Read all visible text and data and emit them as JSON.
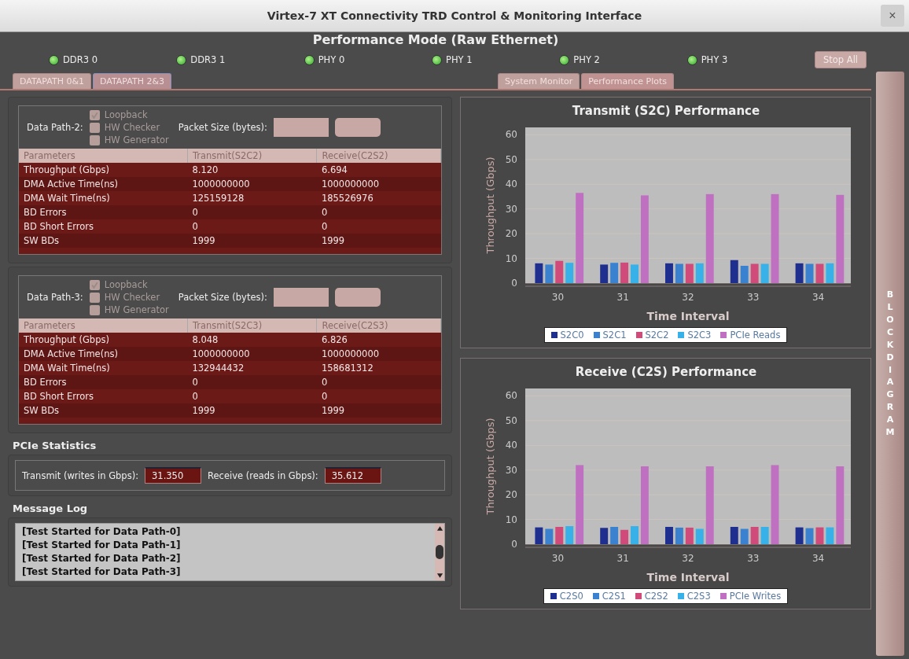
{
  "window": {
    "title": "Virtex-7 XT Connectivity TRD Control & Monitoring Interface",
    "close": "×"
  },
  "mode_title": "Performance Mode (Raw Ethernet)",
  "status_leds": [
    {
      "label": "DDR3 0",
      "on": true
    },
    {
      "label": "DDR3 1",
      "on": true
    },
    {
      "label": "PHY 0",
      "on": true
    },
    {
      "label": "PHY 1",
      "on": true
    },
    {
      "label": "PHY 2",
      "on": true
    },
    {
      "label": "PHY 3",
      "on": true
    }
  ],
  "stop_button": "Stop All",
  "left_tabs": [
    {
      "label": "DATAPATH 0&1",
      "selected": false
    },
    {
      "label": "DATAPATH 2&3",
      "selected": true
    }
  ],
  "right_tabs": [
    {
      "label": "System Monitor",
      "selected": false
    },
    {
      "label": "Performance Plots",
      "selected": true
    }
  ],
  "data_paths": [
    {
      "label": "Data Path-2:",
      "options": [
        {
          "label": "Loopback",
          "checked": true,
          "disabled": true
        },
        {
          "label": "HW Checker",
          "checked": false,
          "disabled": true
        },
        {
          "label": "HW Generator",
          "checked": false,
          "disabled": true
        }
      ],
      "packet_size_label": "Packet Size (bytes):",
      "columns": [
        "Parameters",
        "Transmit(S2C2)",
        "Receive(C2S2)"
      ],
      "rows": [
        [
          "Throughput (Gbps)",
          "8.120",
          "6.694"
        ],
        [
          "DMA Active Time(ns)",
          "1000000000",
          "1000000000"
        ],
        [
          "DMA Wait Time(ns)",
          "125159128",
          "185526976"
        ],
        [
          "BD Errors",
          "0",
          "0"
        ],
        [
          "BD Short Errors",
          "0",
          "0"
        ],
        [
          "SW BDs",
          "1999",
          "1999"
        ]
      ]
    },
    {
      "label": "Data Path-3:",
      "options": [
        {
          "label": "Loopback",
          "checked": true,
          "disabled": true
        },
        {
          "label": "HW Checker",
          "checked": false,
          "disabled": true
        },
        {
          "label": "HW Generator",
          "checked": false,
          "disabled": true
        }
      ],
      "packet_size_label": "Packet Size (bytes):",
      "columns": [
        "Parameters",
        "Transmit(S2C3)",
        "Receive(C2S3)"
      ],
      "rows": [
        [
          "Throughput (Gbps)",
          "8.048",
          "6.826"
        ],
        [
          "DMA Active Time(ns)",
          "1000000000",
          "1000000000"
        ],
        [
          "DMA Wait Time(ns)",
          "132944432",
          "158681312"
        ],
        [
          "BD Errors",
          "0",
          "0"
        ],
        [
          "BD Short Errors",
          "0",
          "0"
        ],
        [
          "SW BDs",
          "1999",
          "1999"
        ]
      ]
    }
  ],
  "pcie_statistics": {
    "heading": "PCIe Statistics",
    "transmit_label": "Transmit (writes in Gbps):",
    "transmit_value": "31.350",
    "receive_label": "Receive (reads in Gbps):",
    "receive_value": "35.612"
  },
  "message_log": {
    "heading": "Message Log",
    "lines": [
      "[Test Started for Data Path-0]",
      "[Test Started for Data Path-1]",
      "[Test Started for Data Path-2]",
      "[Test Started for Data Path-3]"
    ]
  },
  "charts": [
    {
      "chart_data": {
        "type": "bar",
        "title": "Transmit (S2C) Performance",
        "xlabel": "Time Interval",
        "ylabel": "Throughput (Gbps)",
        "categories": [
          "30",
          "31",
          "32",
          "33",
          "34"
        ],
        "grid": true,
        "ylim": [
          0,
          63
        ],
        "yticks": [
          0,
          10,
          20,
          30,
          40,
          50,
          60
        ],
        "series": [
          {
            "name": "S2C0",
            "color": "#1f2f8f",
            "values": [
              8,
              7.5,
              8,
              9.3,
              8
            ]
          },
          {
            "name": "S2C1",
            "color": "#3a82d0",
            "values": [
              7.5,
              8.2,
              7.8,
              7,
              7.8
            ]
          },
          {
            "name": "S2C2",
            "color": "#d04a7a",
            "values": [
              9,
              8.3,
              7.8,
              7.8,
              7.8
            ]
          },
          {
            "name": "S2C3",
            "color": "#38b0e8",
            "values": [
              8.2,
              7.5,
              8,
              7.8,
              8
            ]
          },
          {
            "name": "PCIe Reads",
            "color": "#c070c0",
            "values": [
              36.5,
              35.5,
              36,
              36,
              35.7
            ]
          }
        ]
      }
    },
    {
      "chart_data": {
        "type": "bar",
        "title": "Receive (C2S) Performance",
        "xlabel": "Time Interval",
        "ylabel": "Throughput (Gbps)",
        "categories": [
          "30",
          "31",
          "32",
          "33",
          "34"
        ],
        "grid": true,
        "ylim": [
          0,
          63
        ],
        "yticks": [
          0,
          10,
          20,
          30,
          40,
          50,
          60
        ],
        "series": [
          {
            "name": "C2S0",
            "color": "#1f2f8f",
            "values": [
              6.8,
              6.6,
              7,
              7,
              6.8
            ]
          },
          {
            "name": "C2S1",
            "color": "#3a82d0",
            "values": [
              6.2,
              7,
              6.7,
              6.2,
              6.5
            ]
          },
          {
            "name": "C2S2",
            "color": "#d04a7a",
            "values": [
              7,
              5.8,
              6.7,
              7,
              6.8
            ]
          },
          {
            "name": "C2S3",
            "color": "#38b0e8",
            "values": [
              7.3,
              7.3,
              6.2,
              7,
              6.8
            ]
          },
          {
            "name": "PCIe Writes",
            "color": "#c070c0",
            "values": [
              32,
              31.5,
              31.5,
              32,
              31.5
            ]
          }
        ]
      }
    }
  ],
  "block_diagram_button": "BLOCK DIAGRAM"
}
